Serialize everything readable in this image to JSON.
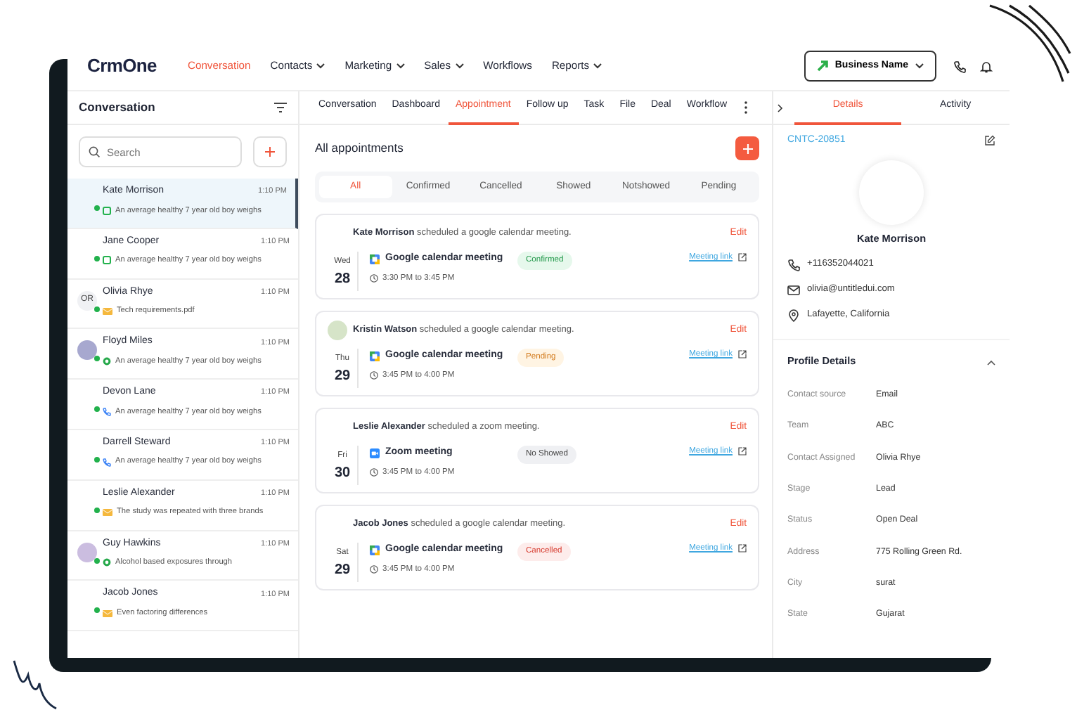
{
  "nav": {
    "logo": "CrmOne",
    "items": [
      {
        "label": "Conversation",
        "selected": true,
        "dropdown": false
      },
      {
        "label": "Contacts",
        "selected": false,
        "dropdown": true
      },
      {
        "label": "Marketing",
        "selected": false,
        "dropdown": true
      },
      {
        "label": "Sales",
        "selected": false,
        "dropdown": true
      },
      {
        "label": "Workflows",
        "selected": false,
        "dropdown": false
      },
      {
        "label": "Reports",
        "selected": false,
        "dropdown": true
      }
    ],
    "business": "Business Name"
  },
  "conversations": {
    "title": "Conversation",
    "search": {
      "placeholder": "Search"
    },
    "items": [
      {
        "name": "Kate Morrison",
        "time": "1:10 PM",
        "preview": "An average healthy 7 year old boy weighs",
        "kind": "sms",
        "avatar": {
          "kind": "none"
        },
        "online": true,
        "selected": true
      },
      {
        "name": "Jane Cooper",
        "time": "1:10 PM",
        "preview": "An average healthy 7 year old boy weighs",
        "kind": "sms",
        "avatar": {
          "kind": "none"
        },
        "online": true,
        "selected": false
      },
      {
        "name": "Olivia Rhye",
        "time": "1:10 PM",
        "preview": "Tech requirements.pdf",
        "kind": "email",
        "avatar": {
          "kind": "initials",
          "text": "OR"
        },
        "online": true,
        "selected": false
      },
      {
        "name": "Floyd Miles",
        "time": "1:10 PM",
        "preview": "An average healthy 7 year old boy weighs",
        "kind": "whatsapp",
        "avatar": {
          "kind": "photo",
          "color": "#a7a8cf"
        },
        "online": true,
        "selected": false
      },
      {
        "name": "Devon Lane",
        "time": "1:10 PM",
        "preview": "An average healthy 7 year old boy weighs",
        "kind": "call",
        "avatar": {
          "kind": "none"
        },
        "online": true,
        "selected": false
      },
      {
        "name": "Darrell Steward",
        "time": "1:10 PM",
        "preview": "An average healthy 7 year old boy weighs",
        "kind": "call",
        "avatar": {
          "kind": "none"
        },
        "online": true,
        "selected": false
      },
      {
        "name": "Leslie Alexander",
        "time": "1:10 PM",
        "preview": "The study was repeated with three brands",
        "kind": "email",
        "avatar": {
          "kind": "none"
        },
        "online": true,
        "selected": false
      },
      {
        "name": "Guy Hawkins",
        "time": "1:10 PM",
        "preview": "Alcohol based exposures through",
        "kind": "whatsapp",
        "avatar": {
          "kind": "photo",
          "color": "#cbbde0"
        },
        "online": true,
        "selected": false
      },
      {
        "name": "Jacob Jones",
        "time": "1:10 PM",
        "preview": "Even factoring differences",
        "kind": "email",
        "avatar": {
          "kind": "none"
        },
        "online": true,
        "selected": false
      }
    ]
  },
  "tabs": [
    {
      "label": "Conversation",
      "selected": false
    },
    {
      "label": "Dashboard",
      "selected": false
    },
    {
      "label": "Appointment",
      "selected": true
    },
    {
      "label": "Follow up",
      "selected": false
    },
    {
      "label": "Task",
      "selected": false
    },
    {
      "label": "File",
      "selected": false
    },
    {
      "label": "Deal",
      "selected": false
    },
    {
      "label": "Workflow",
      "selected": false
    }
  ],
  "appointments": {
    "title": "All appointments",
    "filters": [
      {
        "label": "All",
        "selected": true
      },
      {
        "label": "Confirmed",
        "selected": false
      },
      {
        "label": "Cancelled",
        "selected": false
      },
      {
        "label": "Showed",
        "selected": false
      },
      {
        "label": "Notshowed",
        "selected": false
      },
      {
        "label": "Pending",
        "selected": false
      }
    ],
    "cards": [
      {
        "headline": "**Kate Morrison** scheduled a google calendar meeting.",
        "avatar": {
          "kind": "none"
        },
        "weekday": "Wed",
        "day": "28",
        "meeting": {
          "kind": "google",
          "title": "Google calendar meeting",
          "time": "3:30 PM to 3:45 PM"
        },
        "status": {
          "kind": "confirmed",
          "label": "Confirmed"
        },
        "link": "Meeting link",
        "edit": "Edit"
      },
      {
        "headline": "**Kristin Watson** scheduled a google calendar meeting.",
        "avatar": {
          "kind": "photo",
          "color": "#d6e4c8"
        },
        "weekday": "Thu",
        "day": "29",
        "meeting": {
          "kind": "google",
          "title": "Google calendar meeting",
          "time": "3:45 PM to 4:00 PM"
        },
        "status": {
          "kind": "pending",
          "label": "Pending"
        },
        "link": "Meeting link",
        "edit": "Edit"
      },
      {
        "headline": "**Leslie Alexander** scheduled a zoom meeting.",
        "avatar": {
          "kind": "none"
        },
        "weekday": "Fri",
        "day": "30",
        "meeting": {
          "kind": "zoom",
          "title": "Zoom meeting",
          "time": "3:45 PM to 4:00 PM"
        },
        "status": {
          "kind": "noshow",
          "label": "No Showed"
        },
        "link": "Meeting link",
        "edit": "Edit"
      },
      {
        "headline": "**Jacob Jones** scheduled a google calendar meeting.",
        "avatar": {
          "kind": "none"
        },
        "weekday": "Sat",
        "day": "29",
        "meeting": {
          "kind": "google",
          "title": "Google calendar meeting",
          "time": "3:45 PM to 4:00 PM"
        },
        "status": {
          "kind": "cancelled",
          "label": "Cancelled"
        },
        "link": "Meeting link",
        "edit": "Edit"
      }
    ]
  },
  "details": {
    "tabs": [
      {
        "label": "Details",
        "selected": true
      },
      {
        "label": "Activity",
        "selected": false
      }
    ],
    "contact_id": "CNTC-20851",
    "name": "Kate Morrison",
    "phone": "+116352044021",
    "email": "olivia@untitledui.com",
    "location": "Lafayette, California",
    "profile": {
      "title": "Profile Details",
      "expanded": true,
      "fields": [
        {
          "label": "Contact source",
          "value": "Email"
        },
        {
          "label": "Team",
          "value": "ABC"
        },
        {
          "label": "Contact Assigned",
          "value": "Olivia Rhye"
        },
        {
          "label": "Stage",
          "value": "Lead"
        },
        {
          "label": "Status",
          "value": "Open Deal"
        },
        {
          "label": "Address",
          "value": "775 Rolling Green Rd."
        },
        {
          "label": "City",
          "value": "surat"
        },
        {
          "label": "State",
          "value": "Gujarat"
        }
      ]
    }
  }
}
